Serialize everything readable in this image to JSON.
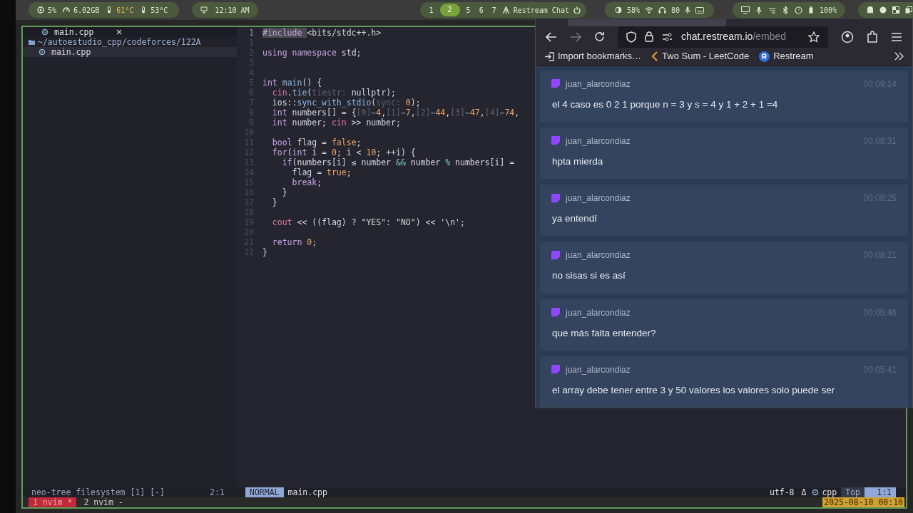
{
  "top_bar": {
    "stats": [
      {
        "kind": "cpu",
        "text": "5%"
      },
      {
        "kind": "memory",
        "text": "6.02GB"
      },
      {
        "kind": "temp_hot",
        "text": "61°C"
      },
      {
        "kind": "temp",
        "text": "53°C"
      }
    ],
    "clock": "12:10 AM",
    "workspaces": [
      {
        "label": "1",
        "selected": false
      },
      {
        "label": "2",
        "selected": true
      },
      {
        "label": "5",
        "selected": false
      },
      {
        "label": "6",
        "selected": false
      },
      {
        "label": "7",
        "selected": false
      }
    ],
    "active_window": "Restream Chat",
    "brightness": "58%",
    "headphones": "80",
    "battery": "100%"
  },
  "editor": {
    "tab": "main.cpp",
    "tree_root": "~/autoestudio_cpp/codeforces/122A",
    "tree_file": "main.cpp",
    "code": [
      {
        "number": "1",
        "current": true,
        "tokens": [
          {
            "kind": "kw",
            "text": "#include "
          },
          {
            "kind": "str",
            "text": "<bits/stdc++.h>"
          }
        ]
      },
      {
        "number": "1",
        "current": false
      },
      {
        "number": "2",
        "current": false,
        "tokens": [
          {
            "kind": "kw",
            "text": "using namespace "
          },
          {
            "kind": "plain",
            "text": "std;"
          }
        ]
      },
      {
        "number": "3",
        "current": false
      },
      {
        "number": "4",
        "current": false
      },
      {
        "number": "5",
        "current": false,
        "tokens": [
          {
            "kind": "kw",
            "text": "int "
          },
          {
            "kind": "fn",
            "text": "main"
          },
          {
            "kind": "plain",
            "text": "() {"
          }
        ]
      },
      {
        "number": "6",
        "current": false,
        "tokens": [
          {
            "kind": "var",
            "text": "  cin"
          },
          {
            "kind": "plain",
            "text": "."
          },
          {
            "kind": "fn",
            "text": "tie"
          },
          {
            "kind": "plain",
            "text": "("
          },
          {
            "kind": "hint",
            "text": "tiestr: "
          },
          {
            "kind": "plain",
            "text": "nullptr);"
          }
        ]
      },
      {
        "number": "7",
        "current": false,
        "tokens": [
          {
            "kind": "plain",
            "text": "  ios::"
          },
          {
            "kind": "fn",
            "text": "sync_with_stdio"
          },
          {
            "kind": "plain",
            "text": "("
          },
          {
            "kind": "hint",
            "text": "sync: "
          },
          {
            "kind": "num",
            "text": "0"
          },
          {
            "kind": "plain",
            "text": ");"
          }
        ]
      },
      {
        "number": "8",
        "current": false,
        "tokens": [
          {
            "kind": "kw",
            "text": "  int "
          },
          {
            "kind": "plain",
            "text": "numbers[] = {"
          },
          {
            "kind": "hint",
            "text": "[0]="
          },
          {
            "kind": "num",
            "text": "4"
          },
          {
            "kind": "plain",
            "text": ","
          },
          {
            "kind": "hint",
            "text": "[1]="
          },
          {
            "kind": "num",
            "text": "7"
          },
          {
            "kind": "plain",
            "text": ","
          },
          {
            "kind": "hint",
            "text": "[2]="
          },
          {
            "kind": "num",
            "text": "44"
          },
          {
            "kind": "plain",
            "text": ","
          },
          {
            "kind": "hint",
            "text": "[3]="
          },
          {
            "kind": "num",
            "text": "47"
          },
          {
            "kind": "plain",
            "text": ","
          },
          {
            "kind": "hint",
            "text": "[4]="
          },
          {
            "kind": "num",
            "text": "74"
          },
          {
            "kind": "plain",
            "text": ","
          }
        ]
      },
      {
        "number": "9",
        "current": false,
        "tokens": [
          {
            "kind": "kw",
            "text": "  int "
          },
          {
            "kind": "plain",
            "text": "number; "
          },
          {
            "kind": "var",
            "text": "cin"
          },
          {
            "kind": "plain",
            "text": " >> number;"
          }
        ]
      },
      {
        "number": "10",
        "current": false
      },
      {
        "number": "11",
        "current": false,
        "tokens": [
          {
            "kind": "kw",
            "text": "  bool "
          },
          {
            "kind": "plain",
            "text": "flag = "
          },
          {
            "kind": "num",
            "text": "false"
          },
          {
            "kind": "plain",
            "text": ";"
          }
        ]
      },
      {
        "number": "12",
        "current": false,
        "tokens": [
          {
            "kind": "kw",
            "text": "  for"
          },
          {
            "kind": "plain",
            "text": "("
          },
          {
            "kind": "kw",
            "text": "int "
          },
          {
            "kind": "plain",
            "text": "i = "
          },
          {
            "kind": "num",
            "text": "0"
          },
          {
            "kind": "plain",
            "text": "; i < "
          },
          {
            "kind": "num",
            "text": "10"
          },
          {
            "kind": "plain",
            "text": "; ++i) {"
          }
        ]
      },
      {
        "number": "13",
        "current": false,
        "tokens": [
          {
            "kind": "kw",
            "text": "    if"
          },
          {
            "kind": "plain",
            "text": "(numbers[i] ≤ number "
          },
          {
            "kind": "op",
            "text": "&&"
          },
          {
            "kind": "plain",
            "text": " number "
          },
          {
            "kind": "op",
            "text": "%"
          },
          {
            "kind": "plain",
            "text": " numbers[i] ="
          }
        ]
      },
      {
        "number": "14",
        "current": false,
        "tokens": [
          {
            "kind": "plain",
            "text": "      flag = "
          },
          {
            "kind": "num",
            "text": "true"
          },
          {
            "kind": "plain",
            "text": ";"
          }
        ]
      },
      {
        "number": "15",
        "current": false,
        "tokens": [
          {
            "kind": "kw",
            "text": "      break"
          },
          {
            "kind": "plain",
            "text": ";"
          }
        ]
      },
      {
        "number": "16",
        "current": false,
        "tokens": [
          {
            "kind": "plain",
            "text": "    }"
          }
        ]
      },
      {
        "number": "17",
        "current": false,
        "tokens": [
          {
            "kind": "plain",
            "text": "  }"
          }
        ]
      },
      {
        "number": "18",
        "current": false
      },
      {
        "number": "19",
        "current": false,
        "tokens": [
          {
            "kind": "var",
            "text": "  cout"
          },
          {
            "kind": "plain",
            "text": " << ((flag) ? "
          },
          {
            "kind": "str",
            "text": "\"YES\""
          },
          {
            "kind": "plain",
            "text": ": "
          },
          {
            "kind": "str",
            "text": "\"NO\""
          },
          {
            "kind": "plain",
            "text": ") << "
          },
          {
            "kind": "str",
            "text": "'\\n'"
          },
          {
            "kind": "plain",
            "text": ";"
          }
        ]
      },
      {
        "number": "20",
        "current": false
      },
      {
        "number": "21",
        "current": false,
        "tokens": [
          {
            "kind": "kw",
            "text": "  return "
          },
          {
            "kind": "num",
            "text": "0"
          },
          {
            "kind": "plain",
            "text": ";"
          }
        ]
      },
      {
        "number": "22",
        "current": false,
        "tokens": [
          {
            "kind": "plain",
            "text": "}"
          }
        ]
      }
    ],
    "status": {
      "left": "neo-tree filesystem [1] [-]",
      "position_left": "2:1",
      "mode": "NORMAL",
      "file": "main.cpp",
      "encoding": "utf-8",
      "delta": "Δ",
      "filetype": "cpp",
      "scroll": "Top",
      "position": "1:1"
    }
  },
  "tmux": {
    "windows": [
      {
        "label": "1 nvim *",
        "selected": true
      },
      {
        "label": "2 nvim -",
        "selected": false
      }
    ],
    "datetime": "2025-08-10 00:10"
  },
  "browser": {
    "url_host": "chat.restream.io",
    "url_path": "/embed",
    "bookmarks": [
      {
        "kind": "import",
        "label": "Import bookmarks…"
      },
      {
        "kind": "leetcode",
        "label": "Two Sum - LeetCode"
      },
      {
        "kind": "restream",
        "label": "Restream"
      }
    ],
    "messages": [
      {
        "user": "juan_alarcondiaz",
        "time": "00:09:14",
        "text": "el 4 caso es 0 2 1 porque n = 3 y s = 4 y 1 + 2 + 1 =4"
      },
      {
        "user": "juan_alarcondiaz",
        "time": "00:08:31",
        "text": "hpta mierda"
      },
      {
        "user": "juan_alarcondiaz",
        "time": "00:08:25",
        "text": "ya entendí"
      },
      {
        "user": "juan_alarcondiaz",
        "time": "00:08:21",
        "text": "no sisas si es así"
      },
      {
        "user": "juan_alarcondiaz",
        "time": "00:05:46",
        "text": "que más falta entender?"
      },
      {
        "user": "juan_alarcondiaz",
        "time": "00:05:41",
        "text": "el array debe tener entre 3 y 50 valores los valores solo puede ser"
      }
    ]
  }
}
